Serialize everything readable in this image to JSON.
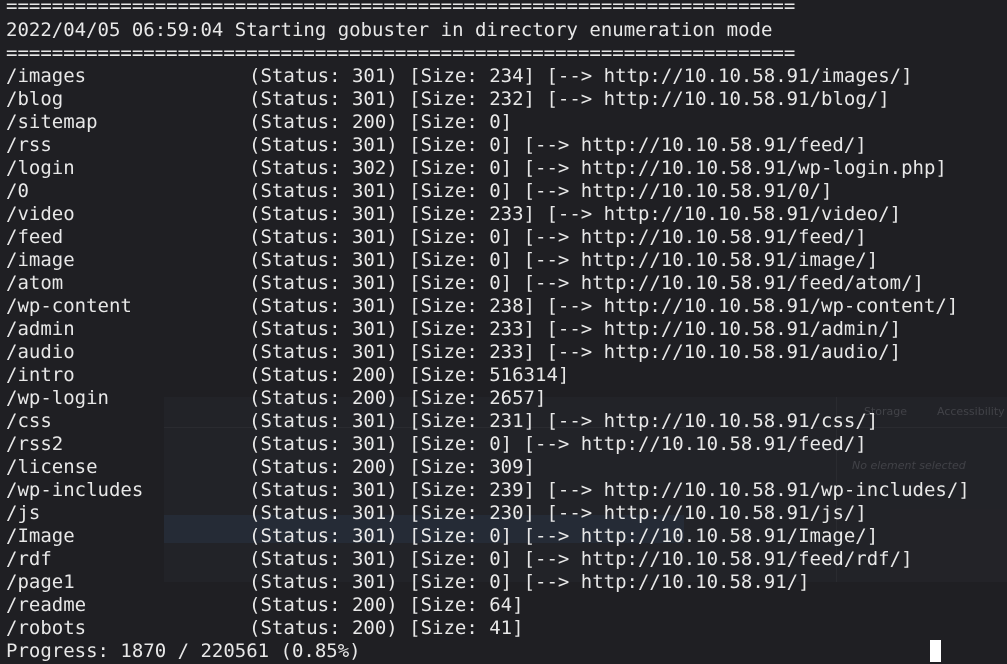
{
  "terminal": {
    "separator": "=====================================================================",
    "header": "2022/04/05 06:59:04 Starting gobuster in directory enumeration mode",
    "results": [
      {
        "path": "/images",
        "status": "(Status: 301)",
        "size": "[Size: 234]",
        "redirect": "[--> http://10.10.58.91/images/]"
      },
      {
        "path": "/blog",
        "status": "(Status: 301)",
        "size": "[Size: 232]",
        "redirect": "[--> http://10.10.58.91/blog/]"
      },
      {
        "path": "/sitemap",
        "status": "(Status: 200)",
        "size": "[Size: 0]",
        "redirect": ""
      },
      {
        "path": "/rss",
        "status": "(Status: 301)",
        "size": "[Size: 0]",
        "redirect": "[--> http://10.10.58.91/feed/]"
      },
      {
        "path": "/login",
        "status": "(Status: 302)",
        "size": "[Size: 0]",
        "redirect": "[--> http://10.10.58.91/wp-login.php]"
      },
      {
        "path": "/0",
        "status": "(Status: 301)",
        "size": "[Size: 0]",
        "redirect": "[--> http://10.10.58.91/0/]"
      },
      {
        "path": "/video",
        "status": "(Status: 301)",
        "size": "[Size: 233]",
        "redirect": "[--> http://10.10.58.91/video/]"
      },
      {
        "path": "/feed",
        "status": "(Status: 301)",
        "size": "[Size: 0]",
        "redirect": "[--> http://10.10.58.91/feed/]"
      },
      {
        "path": "/image",
        "status": "(Status: 301)",
        "size": "[Size: 0]",
        "redirect": "[--> http://10.10.58.91/image/]"
      },
      {
        "path": "/atom",
        "status": "(Status: 301)",
        "size": "[Size: 0]",
        "redirect": "[--> http://10.10.58.91/feed/atom/]"
      },
      {
        "path": "/wp-content",
        "status": "(Status: 301)",
        "size": "[Size: 238]",
        "redirect": "[--> http://10.10.58.91/wp-content/]"
      },
      {
        "path": "/admin",
        "status": "(Status: 301)",
        "size": "[Size: 233]",
        "redirect": "[--> http://10.10.58.91/admin/]"
      },
      {
        "path": "/audio",
        "status": "(Status: 301)",
        "size": "[Size: 233]",
        "redirect": "[--> http://10.10.58.91/audio/]"
      },
      {
        "path": "/intro",
        "status": "(Status: 200)",
        "size": "[Size: 516314]",
        "redirect": ""
      },
      {
        "path": "/wp-login",
        "status": "(Status: 200)",
        "size": "[Size: 2657]",
        "redirect": ""
      },
      {
        "path": "/css",
        "status": "(Status: 301)",
        "size": "[Size: 231]",
        "redirect": "[--> http://10.10.58.91/css/]"
      },
      {
        "path": "/rss2",
        "status": "(Status: 301)",
        "size": "[Size: 0]",
        "redirect": "[--> http://10.10.58.91/feed/]"
      },
      {
        "path": "/license",
        "status": "(Status: 200)",
        "size": "[Size: 309]",
        "redirect": ""
      },
      {
        "path": "/wp-includes",
        "status": "(Status: 301)",
        "size": "[Size: 239]",
        "redirect": "[--> http://10.10.58.91/wp-includes/]"
      },
      {
        "path": "/js",
        "status": "(Status: 301)",
        "size": "[Size: 230]",
        "redirect": "[--> http://10.10.58.91/js/]"
      },
      {
        "path": "/Image",
        "status": "(Status: 301)",
        "size": "[Size: 0]",
        "redirect": "[--> http://10.10.58.91/Image/]"
      },
      {
        "path": "/rdf",
        "status": "(Status: 301)",
        "size": "[Size: 0]",
        "redirect": "[--> http://10.10.58.91/feed/rdf/]"
      },
      {
        "path": "/page1",
        "status": "(Status: 301)",
        "size": "[Size: 0]",
        "redirect": "[--> http://10.10.58.91/]"
      },
      {
        "path": "/readme",
        "status": "(Status: 200)",
        "size": "[Size: 64]",
        "redirect": ""
      },
      {
        "path": "/robots",
        "status": "(Status: 200)",
        "size": "[Size: 41]",
        "redirect": ""
      }
    ],
    "progress": "Progress: 1870 / 220561 (0.85%)"
  },
  "background_panel": {
    "storage_label": "Storage",
    "accessibility_label": "Accessibility",
    "no_element_label": "No element selected"
  },
  "colors": {
    "background": "#1f1f23",
    "foreground": "#e8e8e8",
    "cursor": "#ffffff"
  }
}
